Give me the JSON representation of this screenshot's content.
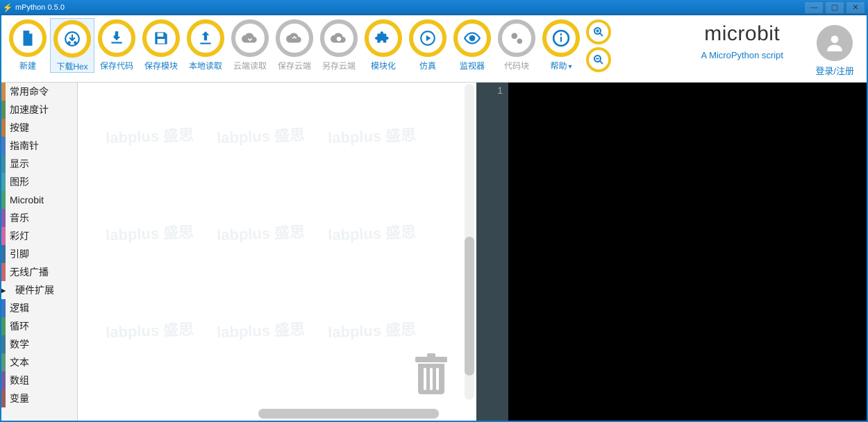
{
  "window": {
    "title": "mPython 0.5.0"
  },
  "toolbar": [
    {
      "id": "new",
      "label": "新建",
      "icon": "file",
      "style": "y"
    },
    {
      "id": "download-hex",
      "label": "下载Hex",
      "icon": "download-chip",
      "style": "y",
      "active": true
    },
    {
      "id": "save-code",
      "label": "保存代码",
      "icon": "download",
      "style": "y"
    },
    {
      "id": "save-module",
      "label": "保存模块",
      "icon": "floppy",
      "style": "y"
    },
    {
      "id": "local-load",
      "label": "本地读取",
      "icon": "upload",
      "style": "y"
    },
    {
      "id": "cloud-load",
      "label": "云端读取",
      "icon": "cloud-down",
      "style": "g"
    },
    {
      "id": "save-cloud",
      "label": "保存云端",
      "icon": "cloud-up",
      "style": "g"
    },
    {
      "id": "save-as-cloud",
      "label": "另存云端",
      "icon": "cloud-link",
      "style": "g"
    },
    {
      "id": "modularize",
      "label": "模块化",
      "icon": "puzzle",
      "style": "y"
    },
    {
      "id": "simulate",
      "label": "仿真",
      "icon": "play",
      "style": "y"
    },
    {
      "id": "monitor",
      "label": "监视器",
      "icon": "eye",
      "style": "y"
    },
    {
      "id": "code-blocks",
      "label": "代码块",
      "icon": "gears",
      "style": "g"
    },
    {
      "id": "help",
      "label": "帮助",
      "icon": "info",
      "style": "y",
      "caret": true
    }
  ],
  "branding": {
    "title": "microbit",
    "subtitle": "A MicroPython script"
  },
  "account": {
    "login_label": "登录/注册"
  },
  "categories": [
    {
      "label": "常用命令",
      "color": "#d28a45"
    },
    {
      "label": "加速度计",
      "color": "#5a8f57"
    },
    {
      "label": "按键",
      "color": "#c17a3a"
    },
    {
      "label": "指南针",
      "color": "#4a7bbf"
    },
    {
      "label": "显示",
      "color": "#3e8e9e"
    },
    {
      "label": "图形",
      "color": "#45a3a3"
    },
    {
      "label": "Microbit",
      "color": "#4aa06a"
    },
    {
      "label": "音乐",
      "color": "#8f5aa8"
    },
    {
      "label": "彩灯",
      "color": "#d46a9e"
    },
    {
      "label": "引脚",
      "color": "#3a6fa0"
    },
    {
      "label": "无线广播",
      "color": "#c96a6a"
    },
    {
      "label": "硬件扩展",
      "color": "#888888",
      "arrow": true
    },
    {
      "label": "逻辑",
      "color": "#3a75c4"
    },
    {
      "label": "循环",
      "color": "#4a9a5a"
    },
    {
      "label": "数学",
      "color": "#3b7a99"
    },
    {
      "label": "文本",
      "color": "#5a9a78"
    },
    {
      "label": "数组",
      "color": "#7a5aa0"
    },
    {
      "label": "变量",
      "color": "#a05a5a"
    }
  ],
  "editor": {
    "line_numbers": [
      "1"
    ],
    "lines": [
      ""
    ]
  },
  "watermark": "labplus   盛思"
}
